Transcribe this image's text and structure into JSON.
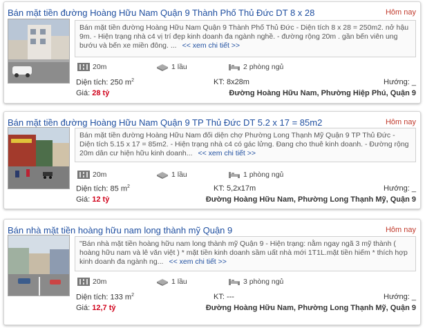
{
  "listings": [
    {
      "title": "Bán mặt tiền đường Hoàng Hữu Nam Quận 9 Thành Phố Thủ Đức DT 8 x 28",
      "date": "Hôm nay",
      "description": "Bán mặt tiền đường Hoàng Hữu Nam Quận 9 Thành Phố Thủ Đức - Diện tích 8 x 28 = 250m2. nở hậu 9m. - Hiện trạng nhà c4 vị trí đẹp kinh doanh đa ngành nghề. - đường rộng 20m . gần bến viên ung bướu và bến xe miền đông. ...",
      "more_link": "<< xem chi tiết >>",
      "road_width": "20m",
      "floors": "1 lầu",
      "bedrooms": "2 phòng ngủ",
      "area_label": "Diện tích: 250 m",
      "area_sup": "2",
      "kt": "KT: 8x28m",
      "direction": "Hướng: _",
      "price_label": "Giá:",
      "price": "28 tỷ",
      "address": "Đường Hoàng Hữu Nam, Phường Hiệp Phú, Quận 9"
    },
    {
      "title": "Bán mặt tiền đường Hoàng Hữu Nam Quận 9 TP Thủ Đức DT 5.2 x 17 = 85m2",
      "date": "Hôm nay",
      "description": "Bán mặt tiền đường Hoàng Hữu Nam đối diện chợ Phường Long Thạnh Mỹ Quận 9 TP Thủ Đức - Diện tích 5.15 x 17 = 85m2. - Hiện trạng nhà c4 có gác lửng. Đang cho thuê kinh doanh. - Đường rộng 20m dân cư hiện hữu kinh doanh...",
      "more_link": "<< xem chi tiết >>",
      "road_width": "20m",
      "floors": "1 lầu",
      "bedrooms": "1 phòng ngủ",
      "area_label": "Diện tích: 85 m",
      "area_sup": "2",
      "kt": "KT: 5,2x17m",
      "direction": "Hướng: _",
      "price_label": "Giá:",
      "price": "12 tỷ",
      "address": "Đường Hoàng Hữu Nam, Phường Long Thạnh Mỹ, Quận 9"
    },
    {
      "title": "Bán nhà mặt tiền hoàng hữu nam long thành mỹ Quận 9",
      "date": "Hôm nay",
      "description": "\"Bán nhà mặt tiền hoàng hữu nam long thành mỹ Quận 9 - Hiện trạng: nằm ngay ngã 3 mỹ thành ( hoàng hữu nam và lê văn việt ) * mặt tiền kinh doanh sầm uất nhà mới 1T1L.mặt tiền hiếm * thích hợp kinh doanh đa ngành ng...",
      "more_link": "<< xem chi tiết >>",
      "road_width": "20m",
      "floors": "1 lầu",
      "bedrooms": "3 phòng ngủ",
      "area_label": "Diện tích: 133 m",
      "area_sup": "2",
      "kt": "KT: ---",
      "direction": "Hướng: _",
      "price_label": "Giá:",
      "price": "12,7 tỷ",
      "address": "Đường Hoàng Hữu Nam, Phường Long Thạnh Mỹ, Quận 9"
    }
  ],
  "colors": {
    "title": "#1f4fa0",
    "date": "#c0392b",
    "price": "#d0021b"
  },
  "icons": {
    "road": "road-width-icon",
    "floors": "floors-icon",
    "bedrooms": "bed-icon"
  }
}
